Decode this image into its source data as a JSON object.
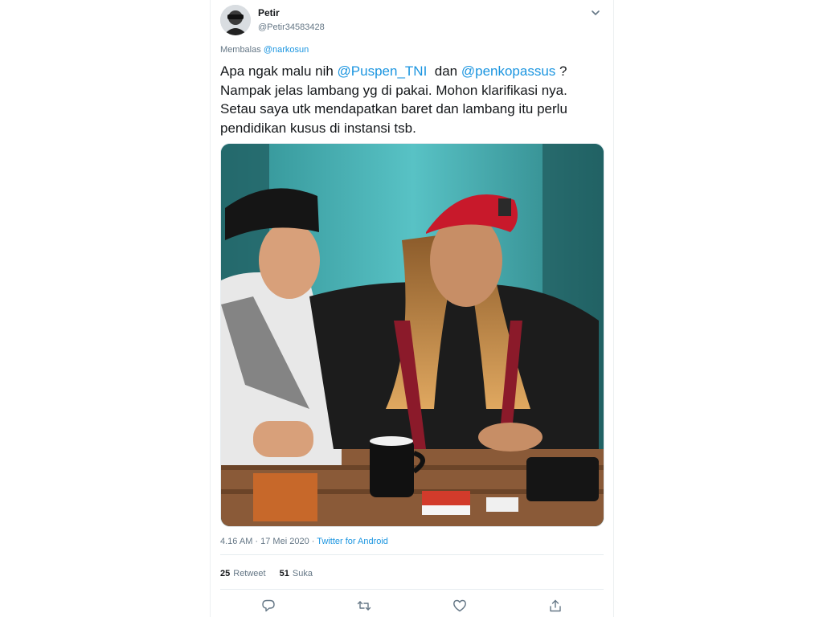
{
  "user": {
    "display_name": "Petir",
    "handle": "@Petir34583428"
  },
  "reply": {
    "prefix": "Membalas",
    "to": "@narkosun"
  },
  "tweet": {
    "part1": "Apa ngak malu nih ",
    "mention1": "@Puspen_TNI",
    "part2": "  dan ",
    "mention2": "@penkopassus",
    "part3": " ?",
    "line2": "Nampak jelas lambang yg di pakai. Mohon klarifikasi nya.",
    "line3": "Setau saya utk mendapatkan baret dan lambang itu perlu",
    "line4": "pendidikan kusus di instansi tsb."
  },
  "meta": {
    "time": "4.16 AM",
    "sep1": " · ",
    "date": "17 Mei 2020",
    "sep2": " · ",
    "source": "Twitter for Android"
  },
  "stats": {
    "retweets_count": "25",
    "retweets_label": "Retweet",
    "likes_count": "51",
    "likes_label": "Suka"
  },
  "icons": {
    "menu": "chevron-down-icon",
    "reply": "reply-icon",
    "retweet": "retweet-icon",
    "like": "heart-icon",
    "share": "share-icon"
  },
  "colors": {
    "link": "#1b95e0",
    "secondary_text": "#657786",
    "primary_text": "#14171a",
    "divider": "#e6ecf0"
  }
}
